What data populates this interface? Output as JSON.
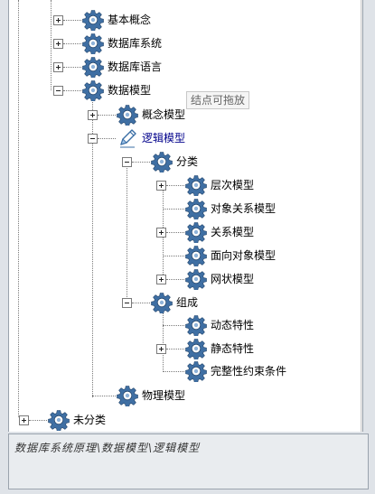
{
  "tree": {
    "nodes": {
      "basic_concepts": "基本概念",
      "database_system": "数据库系统",
      "database_language": "数据库语言",
      "data_model": "数据模型",
      "conceptual_model": "概念模型",
      "logical_model": "逻辑模型",
      "classification": "分类",
      "hierarchical_model": "层次模型",
      "object_relational_model": "对象关系模型",
      "relational_model": "关系模型",
      "object_oriented_model": "面向对象模型",
      "network_model": "网状模型",
      "composition": "组成",
      "dynamic_features": "动态特性",
      "static_features": "静态特性",
      "integrity_constraints": "完整性约束条件",
      "physical_model": "物理模型",
      "uncategorized": "未分类"
    },
    "tooltip": "结点可拖放"
  },
  "path_bar": {
    "path": "数据库系统原理\\数据模型\\逻辑模型"
  },
  "icons": {
    "node": "gear-icon",
    "selected": "pencil-icon"
  },
  "colors": {
    "gear_fill": "#4a7fb5",
    "selected_text": "#00008b"
  }
}
